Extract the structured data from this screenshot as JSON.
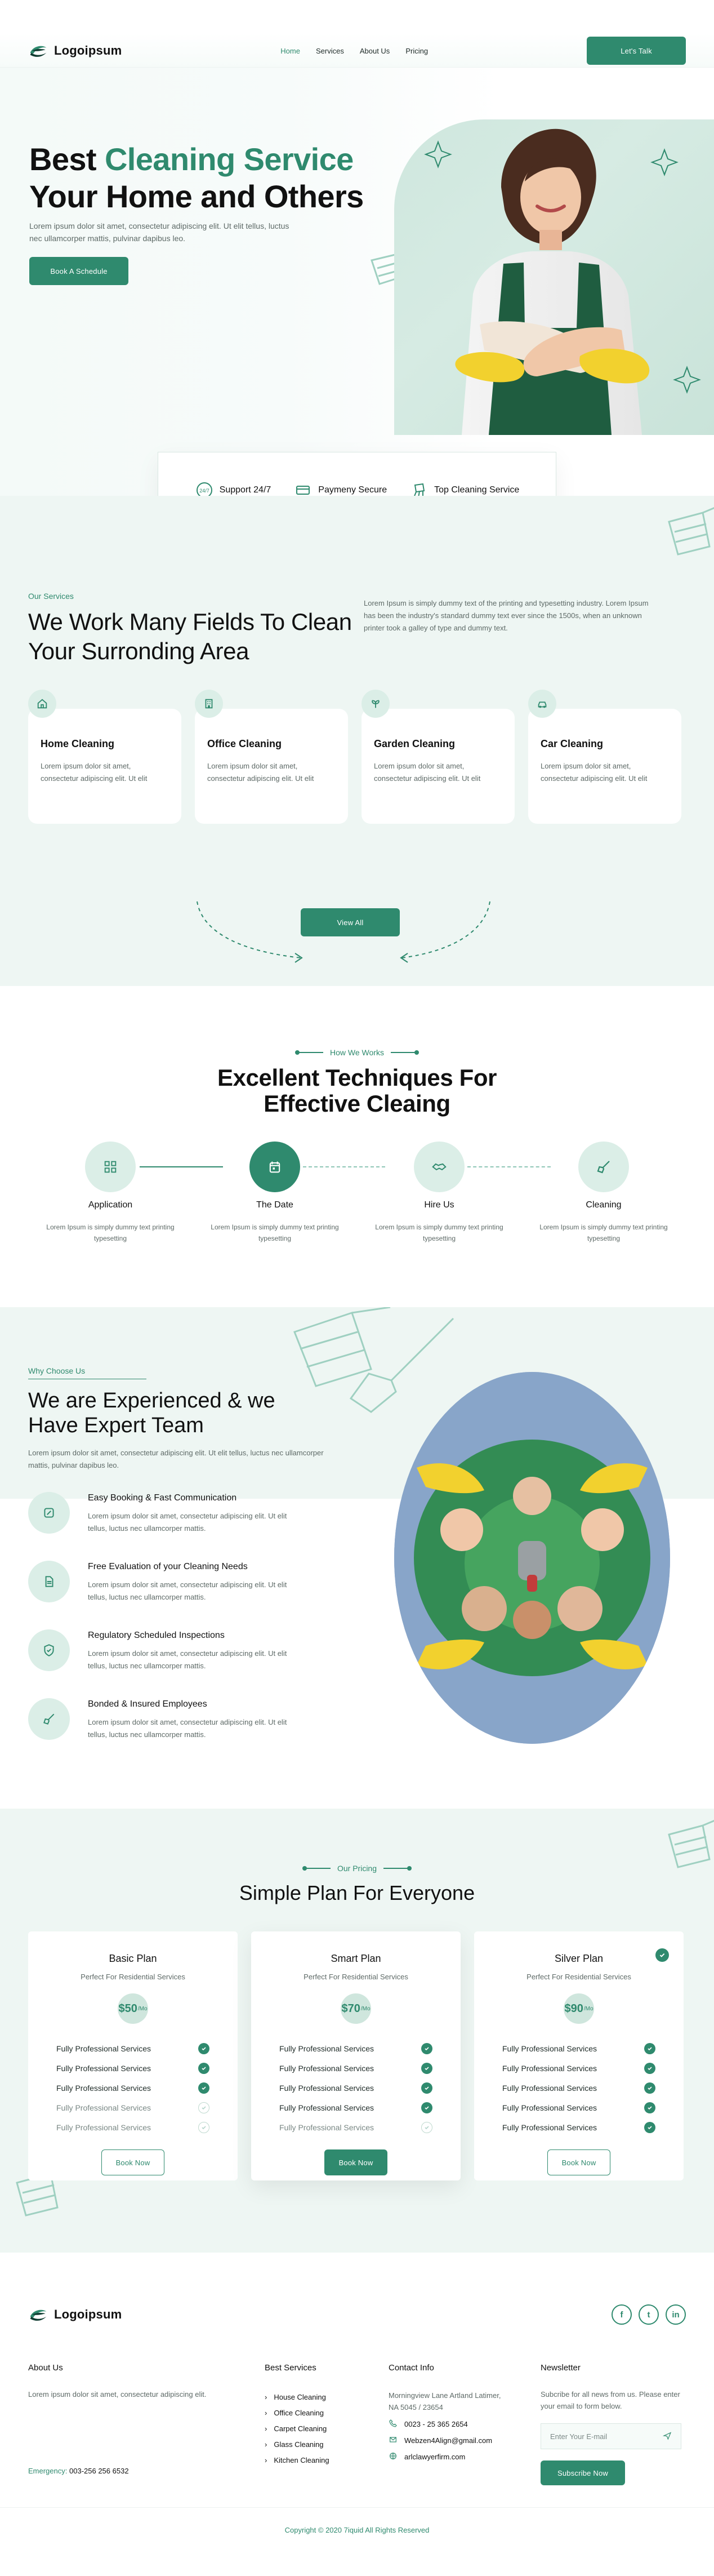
{
  "header": {
    "logo_text": "Logoipsum",
    "nav": [
      "Home",
      "Services",
      "About Us",
      "Pricing"
    ],
    "cta": "Let's Talk"
  },
  "hero": {
    "headline_part1": "Best",
    "headline_highlight": "Cleaning Service",
    "headline_line2": "Your Home and Others",
    "subtext": "Lorem ipsum dolor sit amet, consectetur adipiscing elit. Ut elit tellus, luctus nec ullamcorper mattis, pulvinar dapibus leo.",
    "cta": "Book A Schedule",
    "features": [
      {
        "icon": "badge-247-icon",
        "label": "Support 24/7"
      },
      {
        "icon": "card-icon",
        "label": "Paymeny Secure"
      },
      {
        "icon": "cleaning-icon",
        "label": "Top Cleaning Service"
      }
    ]
  },
  "services": {
    "eyebrow": "Our Services",
    "title": "We Work Many Fields To Clean Your Surronding Area",
    "description": "Lorem Ipsum is simply dummy text of the printing and typesetting industry. Lorem Ipsum has been the industry's standard dummy text ever since the 1500s, when an unknown printer took a galley of type and dummy text.",
    "items": [
      {
        "icon": "home-icon",
        "title": "Home Cleaning",
        "text": "Lorem ipsum dolor sit amet, consectetur adipiscing elit. Ut elit"
      },
      {
        "icon": "building-icon",
        "title": "Office Cleaning",
        "text": "Lorem ipsum dolor sit amet, consectetur adipiscing elit. Ut elit"
      },
      {
        "icon": "plant-icon",
        "title": "Garden Cleaning",
        "text": "Lorem ipsum dolor sit amet, consectetur adipiscing elit. Ut elit"
      },
      {
        "icon": "car-icon",
        "title": "Car Cleaning",
        "text": "Lorem ipsum dolor sit amet, consectetur adipiscing elit. Ut elit"
      }
    ],
    "view_all": "View All"
  },
  "how": {
    "eyebrow": "How We Works",
    "title": "Excellent Techniques For Effective Cleaing",
    "steps": [
      {
        "icon": "grid-icon",
        "label": "Application",
        "text": "Lorem Ipsum is simply dummy text printing typesetting"
      },
      {
        "icon": "calendar-icon",
        "label": "The Date",
        "text": "Lorem Ipsum is simply dummy text printing typesetting"
      },
      {
        "icon": "handshake-icon",
        "label": "Hire Us",
        "text": "Lorem Ipsum is simply dummy text printing typesetting"
      },
      {
        "icon": "broom-icon",
        "label": "Cleaning",
        "text": "Lorem Ipsum is simply dummy text printing typesetting"
      }
    ]
  },
  "why": {
    "eyebrow": "Why Choose Us",
    "title": "We are Experienced & we Have Expert Team",
    "subtext": "Lorem ipsum dolor sit amet, consectetur adipiscing elit. Ut elit tellus, luctus nec ullamcorper mattis, pulvinar dapibus leo.",
    "items": [
      {
        "icon": "edit-icon",
        "title": "Easy Booking & Fast Communication",
        "text": "Lorem ipsum dolor sit amet, consectetur adipiscing elit. Ut elit tellus, luctus nec ullamcorper mattis."
      },
      {
        "icon": "document-icon",
        "title": "Free Evaluation of your Cleaning Needs",
        "text": "Lorem ipsum dolor sit amet, consectetur adipiscing elit. Ut elit tellus, luctus nec ullamcorper mattis."
      },
      {
        "icon": "shield-icon",
        "title": "Regulatory Scheduled Inspections",
        "text": "Lorem ipsum dolor sit amet, consectetur adipiscing elit. Ut elit tellus, luctus nec ullamcorper mattis."
      },
      {
        "icon": "broom-icon",
        "title": "Bonded & Insured Employees",
        "text": "Lorem ipsum dolor sit amet, consectetur adipiscing elit. Ut elit tellus, luctus nec ullamcorper mattis."
      }
    ]
  },
  "pricing": {
    "eyebrow": "Our Pricing",
    "title": "Simple Plan For Everyone",
    "plans": [
      {
        "name": "Basic Plan",
        "tag": "Perfect For Residential Services",
        "price": "$50",
        "price_unit": "/Mo",
        "features": [
          {
            "label": "Fully Professional Services",
            "included": true
          },
          {
            "label": "Fully Professional Services",
            "included": true
          },
          {
            "label": "Fully Professional Services",
            "included": true
          },
          {
            "label": "Fully Professional Services",
            "included": false
          },
          {
            "label": "Fully Professional Services",
            "included": false
          }
        ],
        "button": "Book Now",
        "featured": false
      },
      {
        "name": "Smart Plan",
        "tag": "Perfect For Residential Services",
        "price": "$70",
        "price_unit": "/Mo",
        "features": [
          {
            "label": "Fully Professional Services",
            "included": true
          },
          {
            "label": "Fully Professional Services",
            "included": true
          },
          {
            "label": "Fully Professional Services",
            "included": true
          },
          {
            "label": "Fully Professional Services",
            "included": true
          },
          {
            "label": "Fully Professional Services",
            "included": false
          }
        ],
        "button": "Book Now",
        "featured": true
      },
      {
        "name": "Silver Plan",
        "tag": "Perfect For Residential Services",
        "price": "$90",
        "price_unit": "/Mo",
        "features": [
          {
            "label": "Fully Professional Services",
            "included": true
          },
          {
            "label": "Fully Professional Services",
            "included": true
          },
          {
            "label": "Fully Professional Services",
            "included": true
          },
          {
            "label": "Fully Professional Services",
            "included": true
          },
          {
            "label": "Fully Professional Services",
            "included": true
          }
        ],
        "button": "Book Now",
        "featured": false
      }
    ]
  },
  "footer": {
    "logo_text": "Logoipsum",
    "social": [
      "f",
      "t",
      "in"
    ],
    "about_title": "About Us",
    "about_text": "Lorem ipsum dolor sit amet, consectetur adipiscing elit.",
    "emergency_label": "Emergency:",
    "emergency_phone": "003-256 256 6532",
    "best_services_title": "Best Services",
    "best_services": [
      "House Cleaning",
      "Office Cleaning",
      "Carpet Cleaning",
      "Glass Cleaning",
      "Kitchen Cleaning"
    ],
    "contact_title": "Contact Info",
    "address": "Morningview Lane Artland Latimer, NA 5045 / 23654",
    "phone": "0023 - 25 365 2654",
    "email": "Webzen4Align@gmail.com",
    "website": "arlclawyerfirm.com",
    "newsletter_title": "Newsletter",
    "newsletter_text": "Subcribe for all news from us. Please enter your email to form below.",
    "email_placeholder": "Enter Your E-mail",
    "subscribe": "Subscribe Now",
    "copyright": "Copyright © 2020 7iquid All Rights Reserved"
  },
  "colors": {
    "accent": "#2f8a6e",
    "mint_bg": "#eef6f3"
  }
}
